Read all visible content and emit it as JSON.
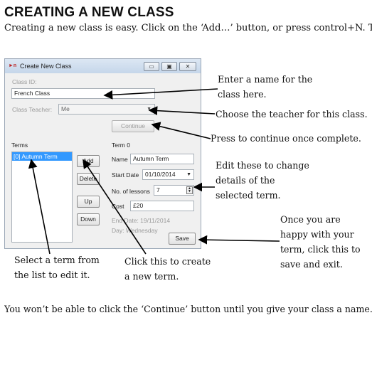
{
  "heading": "CREATING A NEW CLASS",
  "intro": "Creating a new class is easy. Click on the ‘Add…’ button, or press control+N. The followi appear:",
  "window": {
    "title": "Create New Class",
    "class_id_label": "Class ID:",
    "class_id_value": "French Class",
    "class_teacher_label": "Class Teacher:",
    "class_teacher_value": "Me",
    "continue_label": "Continue",
    "terms_label": "Terms",
    "terms_list": [
      "[0] Autumn Term"
    ],
    "add_label": "Add",
    "delete_label": "Delete",
    "up_label": "Up",
    "down_label": "Down",
    "term_header": "Term 0",
    "name_label": "Name",
    "name_value": "Autumn Term",
    "start_date_label": "Start Date",
    "start_date_value": "01/10/2014",
    "lessons_label": "No. of lessons",
    "lessons_value": "7",
    "cost_label": "Cost",
    "cost_value": "£20",
    "end_date_text": "End Date: 19/11/2014",
    "day_text": "Day: Wednesday",
    "save_label": "Save"
  },
  "callouts": {
    "enter_name": "Enter a name for the class here.",
    "choose_teacher": "Choose the teacher for this class.",
    "press_continue": "Press to continue once complete.",
    "edit_details": "Edit these to change details of the selected term.",
    "once_happy": "Once you are happy with your term, click this to save and exit.",
    "select_term": "Select a term from the list to edit it.",
    "click_create": "Click this to create a new term."
  },
  "paragraph": "You won’t be able to click the ‘Continue’ button until you give your class a name. By def logged in user will be the teacher, but that can be changed with the drop-down menu. T of weekly lessons, and you can have up to 10 lessons per term. The grey text at the bott screen tell you what day of the week the lesson will occur, and when it will end."
}
